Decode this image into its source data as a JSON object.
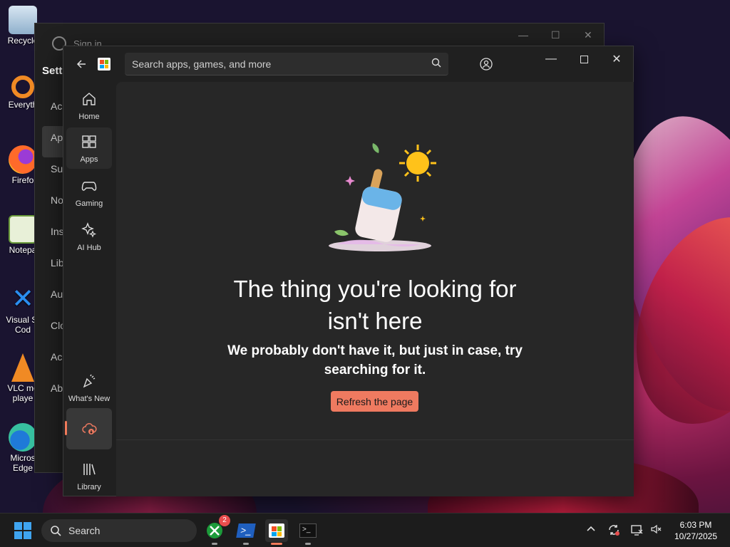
{
  "desktop": {
    "icons": [
      {
        "label": "Recycle"
      },
      {
        "label": "Everyth"
      },
      {
        "label": "Firefo"
      },
      {
        "label": "Notepa"
      },
      {
        "label": "Visual St Cod"
      },
      {
        "label": "VLC me playe"
      },
      {
        "label": "Micros Edge"
      }
    ]
  },
  "background_window": {
    "signin": "Sign in",
    "title": "Sett",
    "nav": [
      "Acc",
      "Ap",
      "Sul",
      "No",
      "Ins",
      "Lib",
      "Au",
      "Clo",
      "Acc",
      "Ab"
    ]
  },
  "store": {
    "search_placeholder": "Search apps, games, and more",
    "nav": {
      "home": "Home",
      "apps": "Apps",
      "gaming": "Gaming",
      "ai_hub": "AI Hub",
      "whats_new": "What's New",
      "library": "Library"
    },
    "heading_line1": "The thing you're looking for",
    "heading_line2": "isn't here",
    "sub_line1": "We probably don't have it, but just in case, try",
    "sub_line2": "searching for it.",
    "refresh": "Refresh the page",
    "accent": "#ef7a60"
  },
  "taskbar": {
    "search": "Search",
    "xbox_badge": "2",
    "time": "6:03 PM",
    "date": "10/27/2025"
  }
}
